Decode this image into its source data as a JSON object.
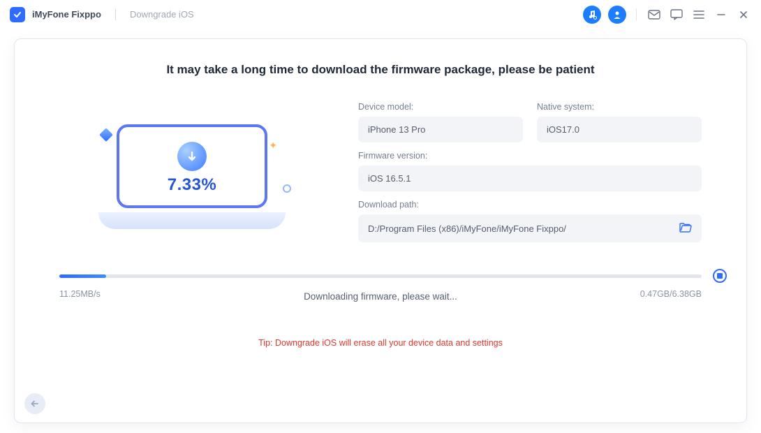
{
  "titlebar": {
    "app_name": "iMyFone Fixppo",
    "subtitle": "Downgrade iOS"
  },
  "main": {
    "headline": "It may take a long time to download the firmware package, please be patient",
    "progress_percent": "7.33%",
    "device_model_label": "Device model:",
    "device_model_value": "iPhone 13 Pro",
    "native_system_label": "Native system:",
    "native_system_value": "iOS17.0",
    "firmware_version_label": "Firmware version:",
    "firmware_version_value": "iOS 16.5.1",
    "download_path_label": "Download path:",
    "download_path_value": "D:/Program Files (x86)/iMyFone/iMyFone Fixppo/",
    "speed": "11.25MB/s",
    "status_text": "Downloading firmware, please wait...",
    "size_text": "0.47GB/6.38GB",
    "progress_bar_width": "7.33%",
    "tip": "Tip: Downgrade iOS will erase all your device data and settings"
  }
}
